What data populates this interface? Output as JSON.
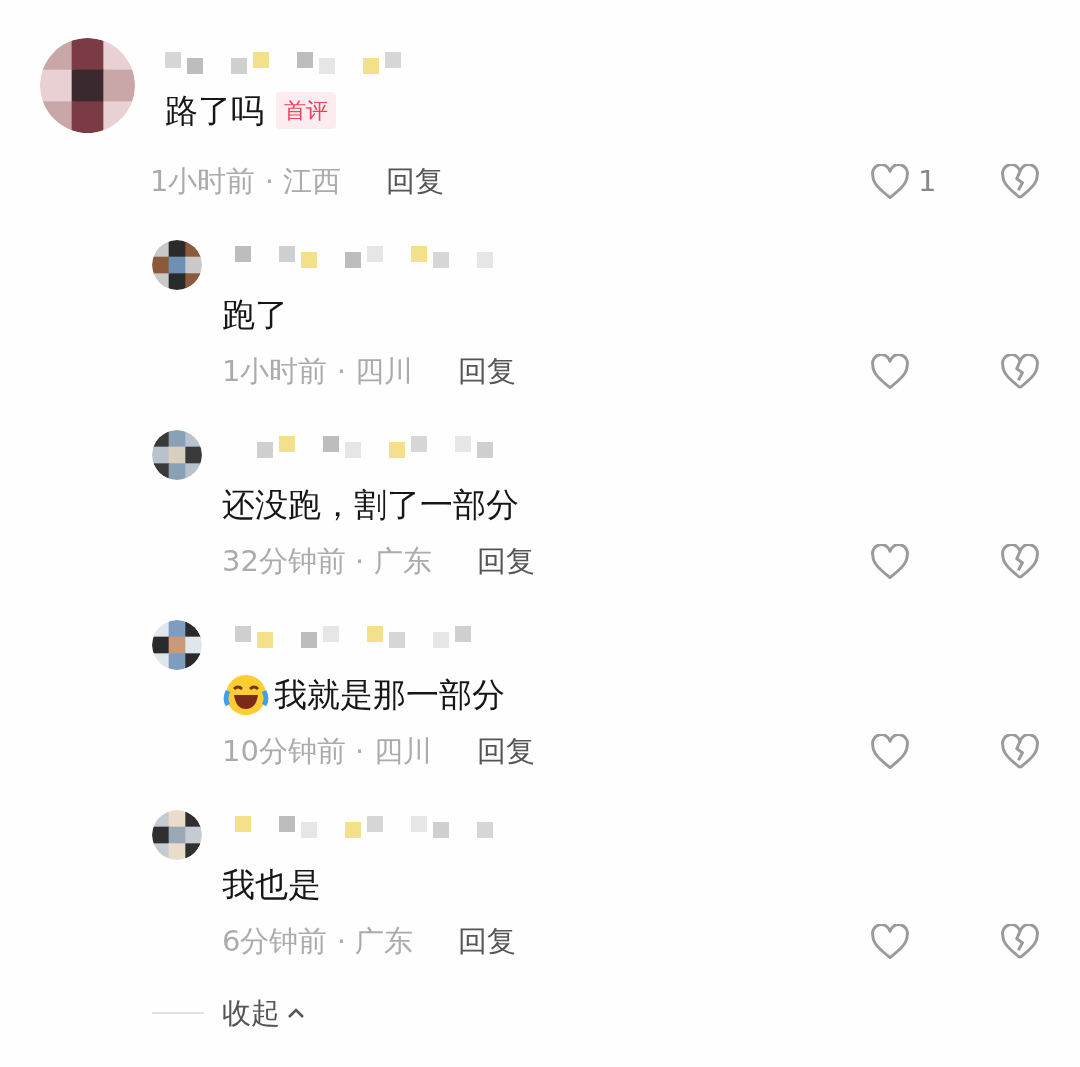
{
  "comment": {
    "text": "路了吗",
    "badge": "首评",
    "meta": "1小时前 · 江西",
    "reply_label": "回复",
    "like_count": "1",
    "liked": false
  },
  "replies": [
    {
      "kind": "text",
      "text": "跑了",
      "meta": "1小时前 · 四川",
      "reply_label": "回复",
      "liked": false
    },
    {
      "kind": "text",
      "text": "还没跑，割了一部分",
      "meta": "32分钟前 · 广东",
      "reply_label": "回复",
      "liked": false
    },
    {
      "kind": "emoji_text",
      "text": "我就是那一部分",
      "meta": "10分钟前 · 四川",
      "reply_label": "回复",
      "liked": false
    },
    {
      "kind": "text",
      "text": "我也是",
      "meta": "6分钟前 · 广东",
      "reply_label": "回复",
      "liked": false
    }
  ],
  "collapse_label": "收起"
}
